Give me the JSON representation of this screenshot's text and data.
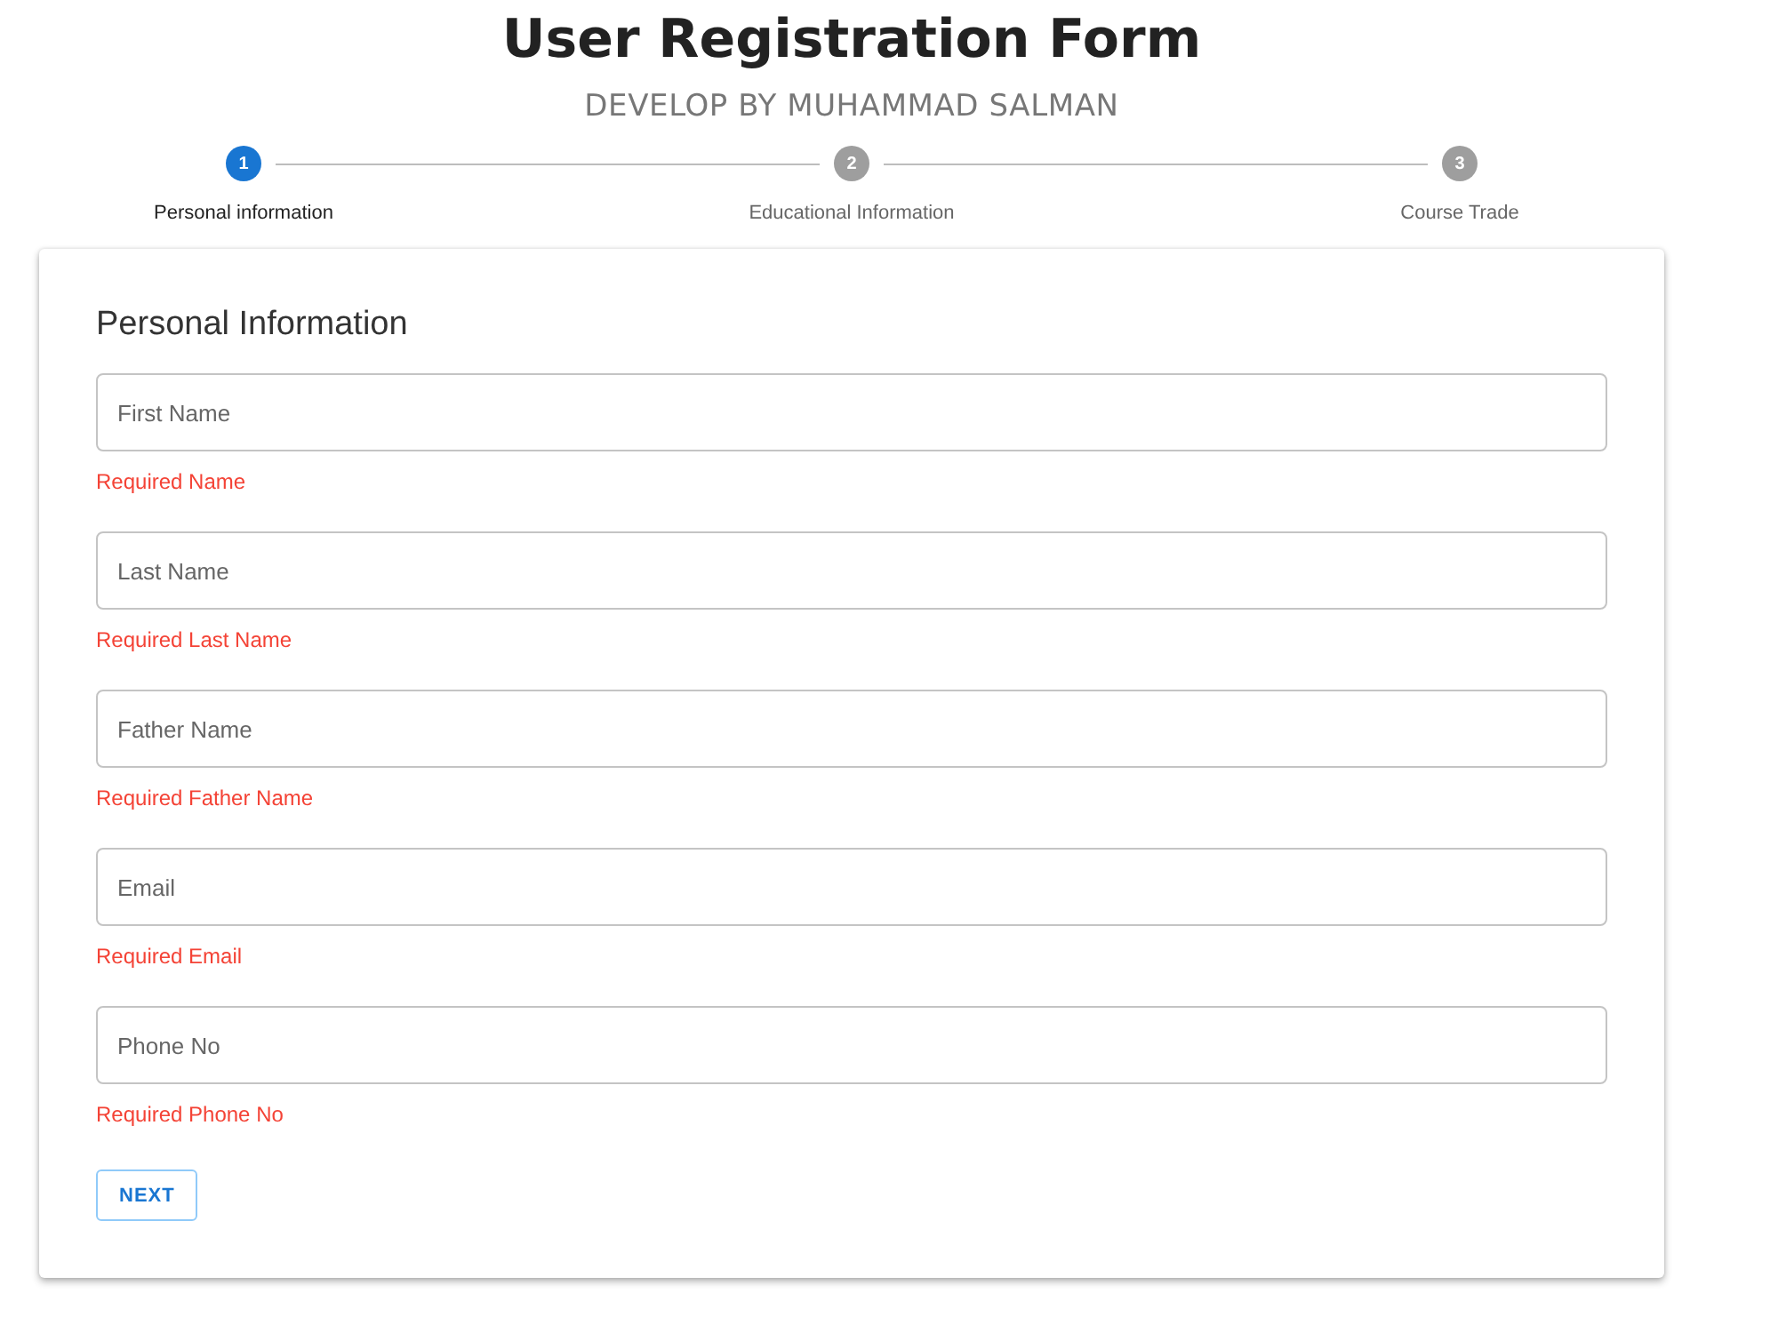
{
  "header": {
    "title": "User Registration Form",
    "subtitle": "DEVELOP BY MUHAMMAD SALMAN"
  },
  "steps": [
    {
      "number": "1",
      "label": "Personal information",
      "selected": true
    },
    {
      "number": "2",
      "label": "Educational Information",
      "selected": false
    },
    {
      "number": "3",
      "label": "Course Trade",
      "selected": false
    }
  ],
  "form": {
    "title": "Personal Information",
    "fields": [
      {
        "placeholder": "First Name",
        "error": "Required Name"
      },
      {
        "placeholder": "Last Name",
        "error": "Required Last Name"
      },
      {
        "placeholder": "Father Name",
        "error": "Required Father Name"
      },
      {
        "placeholder": "Email",
        "error": "Required Email"
      },
      {
        "placeholder": "Phone No",
        "error": "Required Phone No"
      }
    ],
    "button": "NEXT"
  }
}
